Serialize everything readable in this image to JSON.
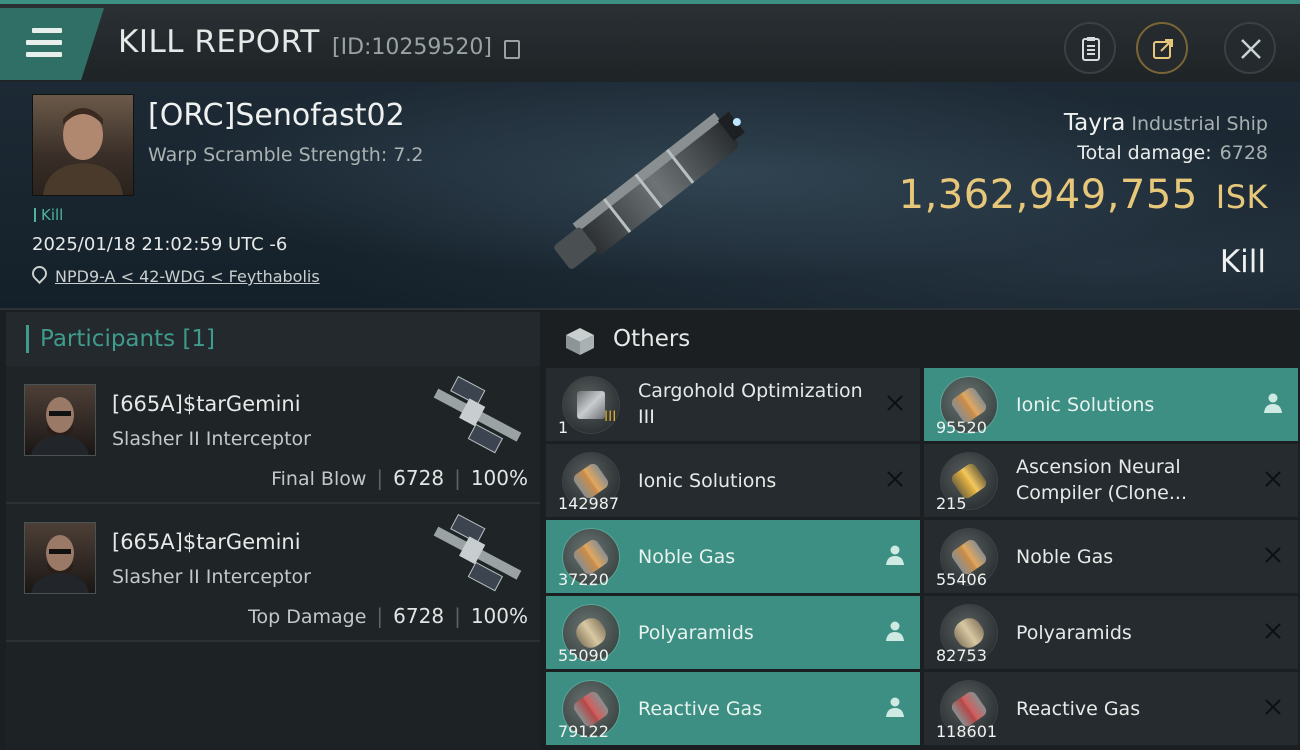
{
  "header": {
    "title": "KILL REPORT",
    "report_id": "[ID:10259520]"
  },
  "victim": {
    "name": "[ORC]Senofast02",
    "warp_scramble": "Warp Scramble Strength: 7.2",
    "kill_tag": "Kill",
    "datetime": "2025/01/18 21:02:59 UTC -6",
    "location": "NPD9-A < 42-WDG < Feythabolis",
    "ship_name": "Tayra",
    "ship_class": "Industrial Ship",
    "total_damage_label": "Total damage:",
    "total_damage": "6728",
    "isk_value": "1,362,949,755",
    "isk_unit": "ISK",
    "outcome": "Kill"
  },
  "participants": {
    "label": "Participants [1]",
    "rows": [
      {
        "name": "[665A]$tarGemini",
        "ship": "Slasher II Interceptor",
        "role": "Final Blow",
        "damage": "6728",
        "percent": "100%"
      },
      {
        "name": "[665A]$tarGemini",
        "ship": "Slasher II Interceptor",
        "role": "Top Damage",
        "damage": "6728",
        "percent": "100%"
      }
    ]
  },
  "items": {
    "label": "Others",
    "list": [
      {
        "name": "Cargohold Optimization III",
        "qty": "1",
        "meta": "III",
        "status": "destroyed",
        "icon": "module-icon"
      },
      {
        "name": "Ionic Solutions",
        "qty": "95520",
        "status": "dropped",
        "icon": "gas-canister-icon"
      },
      {
        "name": "Ionic Solutions",
        "qty": "142987",
        "status": "destroyed",
        "icon": "gas-canister-icon"
      },
      {
        "name": "Ascension Neural Compiler (Clone...",
        "qty": "215",
        "status": "destroyed",
        "icon": "neural-compiler-icon"
      },
      {
        "name": "Noble Gas",
        "qty": "37220",
        "status": "dropped",
        "icon": "gas-canister-icon"
      },
      {
        "name": "Noble Gas",
        "qty": "55406",
        "status": "destroyed",
        "icon": "gas-canister-icon"
      },
      {
        "name": "Polyaramids",
        "qty": "55090",
        "status": "dropped",
        "icon": "polyaramids-icon"
      },
      {
        "name": "Polyaramids",
        "qty": "82753",
        "status": "destroyed",
        "icon": "polyaramids-icon"
      },
      {
        "name": "Reactive Gas",
        "qty": "79122",
        "status": "dropped",
        "icon": "reactive-gas-icon"
      },
      {
        "name": "Reactive Gas",
        "qty": "118601",
        "status": "destroyed",
        "icon": "reactive-gas-icon"
      }
    ]
  },
  "colors": {
    "accent": "#3c8f82",
    "isk_gold": "#e7c77a",
    "background": "#1b1f22"
  }
}
